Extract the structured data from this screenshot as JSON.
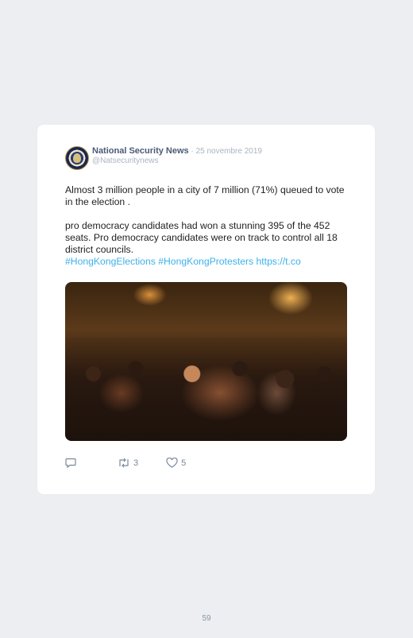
{
  "tweet": {
    "author_name": "National Security News",
    "separator": " · ",
    "date": "25 novembre 2019",
    "handle": "@Natsecuritynews",
    "text_line1": "Almost 3 million people in a city of 7 million (71%) queued to vote in the election .",
    "text_line2": "pro democracy candidates had won a stunning 395 of the 452 seats. Pro democracy candidates were on track to control all 18 district councils.",
    "hashtags": "#HongKongElections #HongKongProtesters https://t.co",
    "retweet_count": "3",
    "like_count": "5"
  },
  "page": {
    "number": "59"
  },
  "icons": {
    "reply": "reply-icon",
    "retweet": "retweet-icon",
    "like": "heart-icon",
    "avatar": "seal-logo"
  },
  "colors": {
    "link": "#3bb2ea",
    "name": "#4b5a77",
    "muted": "#aab3c2"
  }
}
